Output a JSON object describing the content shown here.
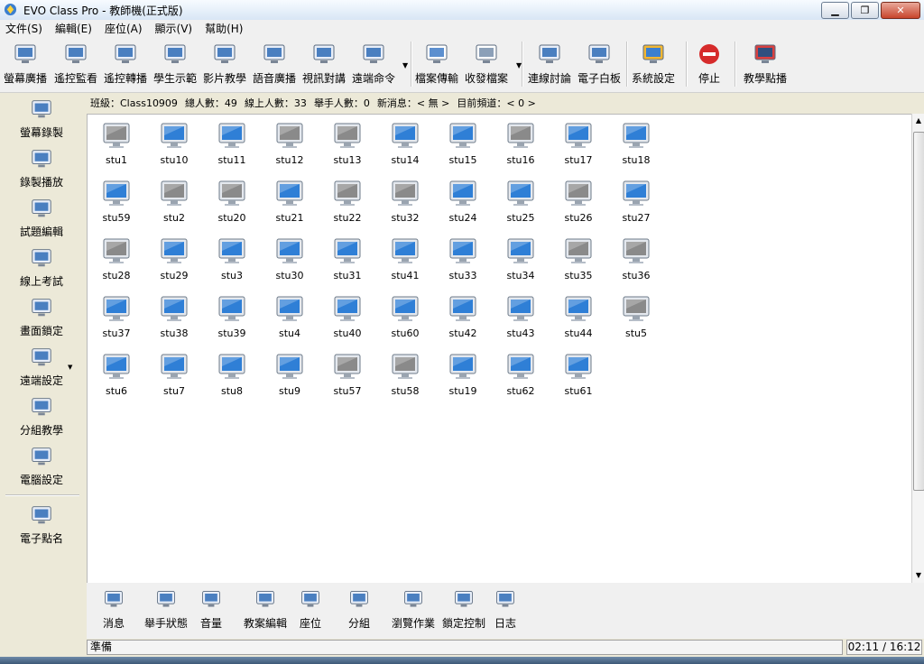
{
  "window": {
    "title": "EVO Class Pro - 教師機(正式版)",
    "minimize": "▁",
    "restore": "❐",
    "close": "✕"
  },
  "menu": [
    {
      "label": "文件(S)"
    },
    {
      "label": "編輯(E)"
    },
    {
      "label": "座位(A)"
    },
    {
      "label": "顯示(V)"
    },
    {
      "label": "幫助(H)"
    }
  ],
  "toolbar": [
    {
      "label": "螢幕廣播",
      "icon": "screen-broadcast-icon"
    },
    {
      "label": "遙控監看",
      "icon": "remote-monitor-icon"
    },
    {
      "label": "遙控轉播",
      "icon": "remote-relay-icon"
    },
    {
      "label": "學生示範",
      "icon": "student-demo-icon"
    },
    {
      "label": "影片教學",
      "icon": "video-teaching-icon"
    },
    {
      "label": "語音廣播",
      "icon": "voice-broadcast-icon"
    },
    {
      "label": "視訊對講",
      "icon": "video-intercom-icon"
    },
    {
      "label": "遠端命令",
      "icon": "remote-command-icon"
    },
    {
      "label": "檔案傳輸",
      "icon": "file-transfer-icon"
    },
    {
      "label": "收發檔案",
      "icon": "file-exchange-icon"
    },
    {
      "label": "連線討論",
      "icon": "online-discussion-icon"
    },
    {
      "label": "電子白板",
      "icon": "whiteboard-icon"
    },
    {
      "label": "系統設定",
      "icon": "system-settings-icon"
    },
    {
      "label": "停止",
      "icon": "stop-icon"
    },
    {
      "label": "教學點播",
      "icon": "teaching-on-demand-icon"
    }
  ],
  "info": {
    "class_label": "班級：Class10909",
    "total_label": "總人數：49",
    "online_label": "線上人數：33",
    "hands_label": "舉手人數：0",
    "news_label": "新消息：< 無 >",
    "channel_label": "目前頻道：< 0 >"
  },
  "sidebar": [
    {
      "label": "螢幕錄製",
      "icon": "screen-record-icon"
    },
    {
      "label": "錄製播放",
      "icon": "record-playback-icon"
    },
    {
      "label": "試題編輯",
      "icon": "exam-edit-icon"
    },
    {
      "label": "線上考試",
      "icon": "online-exam-icon"
    },
    {
      "label": "畫面鎖定",
      "icon": "screen-lock-icon"
    },
    {
      "label": "遠端設定",
      "icon": "remote-settings-icon"
    },
    {
      "label": "分組教學",
      "icon": "group-teaching-icon"
    },
    {
      "label": "電腦設定",
      "icon": "computer-settings-icon"
    },
    {
      "label": "電子點名",
      "icon": "roll-call-icon"
    }
  ],
  "students": [
    {
      "name": "stu1",
      "online": false
    },
    {
      "name": "stu10",
      "online": true
    },
    {
      "name": "stu11",
      "online": true
    },
    {
      "name": "stu12",
      "online": false
    },
    {
      "name": "stu13",
      "online": false
    },
    {
      "name": "stu14",
      "online": true
    },
    {
      "name": "stu15",
      "online": true
    },
    {
      "name": "stu16",
      "online": false
    },
    {
      "name": "stu17",
      "online": true
    },
    {
      "name": "stu18",
      "online": true
    },
    {
      "name": "stu59",
      "online": true
    },
    {
      "name": "stu2",
      "online": false
    },
    {
      "name": "stu20",
      "online": false
    },
    {
      "name": "stu21",
      "online": true
    },
    {
      "name": "stu22",
      "online": false
    },
    {
      "name": "stu32",
      "online": false
    },
    {
      "name": "stu24",
      "online": true
    },
    {
      "name": "stu25",
      "online": true
    },
    {
      "name": "stu26",
      "online": false
    },
    {
      "name": "stu27",
      "online": true
    },
    {
      "name": "stu28",
      "online": false
    },
    {
      "name": "stu29",
      "online": true
    },
    {
      "name": "stu3",
      "online": true
    },
    {
      "name": "stu30",
      "online": true
    },
    {
      "name": "stu31",
      "online": true
    },
    {
      "name": "stu41",
      "online": true
    },
    {
      "name": "stu33",
      "online": true
    },
    {
      "name": "stu34",
      "online": true
    },
    {
      "name": "stu35",
      "online": false
    },
    {
      "name": "stu36",
      "online": false
    },
    {
      "name": "stu37",
      "online": true
    },
    {
      "name": "stu38",
      "online": true
    },
    {
      "name": "stu39",
      "online": true
    },
    {
      "name": "stu4",
      "online": true
    },
    {
      "name": "stu40",
      "online": true
    },
    {
      "name": "stu60",
      "online": true
    },
    {
      "name": "stu42",
      "online": true
    },
    {
      "name": "stu43",
      "online": true
    },
    {
      "name": "stu44",
      "online": true
    },
    {
      "name": "stu5",
      "online": false
    },
    {
      "name": "stu6",
      "online": true
    },
    {
      "name": "stu7",
      "online": true
    },
    {
      "name": "stu8",
      "online": true
    },
    {
      "name": "stu9",
      "online": true
    },
    {
      "name": "stu57",
      "online": false
    },
    {
      "name": "stu58",
      "online": false
    },
    {
      "name": "stu19",
      "online": true
    },
    {
      "name": "stu62",
      "online": true
    },
    {
      "name": "stu61",
      "online": true
    }
  ],
  "bottom_toolbar": [
    {
      "label": "消息",
      "icon": "message-icon"
    },
    {
      "label": "舉手狀態",
      "icon": "hand-raise-icon"
    },
    {
      "label": "音量",
      "icon": "volume-icon"
    },
    {
      "label": "教案編輯",
      "icon": "lesson-plan-icon"
    },
    {
      "label": "座位",
      "icon": "seating-icon"
    },
    {
      "label": "分組",
      "icon": "grouping-icon"
    },
    {
      "label": "瀏覽作業",
      "icon": "browse-homework-icon"
    },
    {
      "label": "鎖定控制",
      "icon": "lock-control-icon"
    },
    {
      "label": "日志",
      "icon": "log-icon"
    }
  ],
  "status": {
    "text": "準備",
    "time": "02:11 / 16:12"
  },
  "colors": {
    "online_screen": "#2f7fd6",
    "offline_screen": "#8a8a8a"
  }
}
